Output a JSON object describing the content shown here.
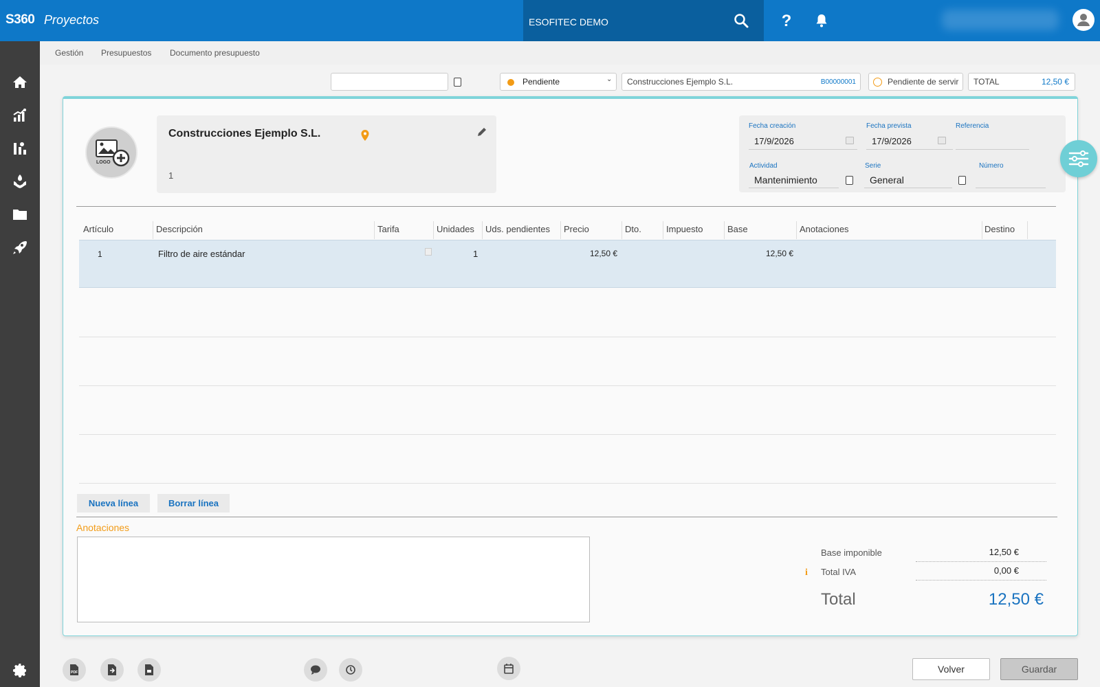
{
  "app": {
    "brand": "S360",
    "name": "Proyectos",
    "company": "ESOFITEC DEMO"
  },
  "breadcrumb": [
    "Gestión",
    "Presupuestos",
    "Documento presupuesto"
  ],
  "header": {
    "status": "Pendiente",
    "client_name": "Construcciones Ejemplo S.L.",
    "client_code": "B00000001",
    "serve_status": "Pendiente de servir",
    "total_label": "TOTAL",
    "total_value": "12,50 €"
  },
  "client_card": {
    "name": "Construcciones Ejemplo S.L.",
    "number": "1"
  },
  "meta": {
    "fecha_creacion_label": "Fecha creación",
    "fecha_creacion": "17/9/2026",
    "fecha_prevista_label": "Fecha prevista",
    "fecha_prevista": "17/9/2026",
    "referencia_label": "Referencia",
    "referencia": "",
    "actividad_label": "Actividad",
    "actividad": "Mantenimiento",
    "serie_label": "Serie",
    "serie": "General",
    "numero_label": "Número",
    "numero": ""
  },
  "table": {
    "columns": [
      "Artículo",
      "Descripción",
      "Tarifa",
      "Unidades",
      "Uds. pendientes",
      "Precio",
      "Dto.",
      "Impuesto",
      "Base",
      "Anotaciones",
      "Destino"
    ],
    "rows": [
      {
        "articulo": "1",
        "descripcion": "Filtro de aire estándar",
        "tarifa": "",
        "unidades": "1",
        "uds_pendientes": "",
        "precio": "12,50 €",
        "dto": "",
        "impuesto": "",
        "base": "12,50 €",
        "anotaciones": "",
        "destino": ""
      }
    ]
  },
  "actions": {
    "new_line": "Nueva línea",
    "delete_line": "Borrar línea"
  },
  "notes": {
    "label": "Anotaciones",
    "value": ""
  },
  "summary": {
    "base_label": "Base imponible",
    "base_value": "12,50 €",
    "iva_label": "Total IVA",
    "iva_value": "0,00 €",
    "total_label": "Total",
    "total_value": "12,50 €"
  },
  "footer": {
    "volver": "Volver",
    "guardar": "Guardar"
  },
  "icons": {
    "sidebar": [
      "home-icon",
      "stats-icon",
      "chart-icon",
      "hand-icon",
      "folder-icon",
      "rocket-icon",
      "gear-icon"
    ],
    "bottom": [
      "pdf-icon",
      "export-document-icon",
      "attachment-document-icon",
      "comment-icon",
      "history-icon",
      "calendar-icon"
    ]
  },
  "colors": {
    "topbar": "#0e78c8",
    "sidebar": "#3e3e3e",
    "accent": "#1a73c0",
    "orange": "#f29b16",
    "teal": "#7fd4da"
  }
}
